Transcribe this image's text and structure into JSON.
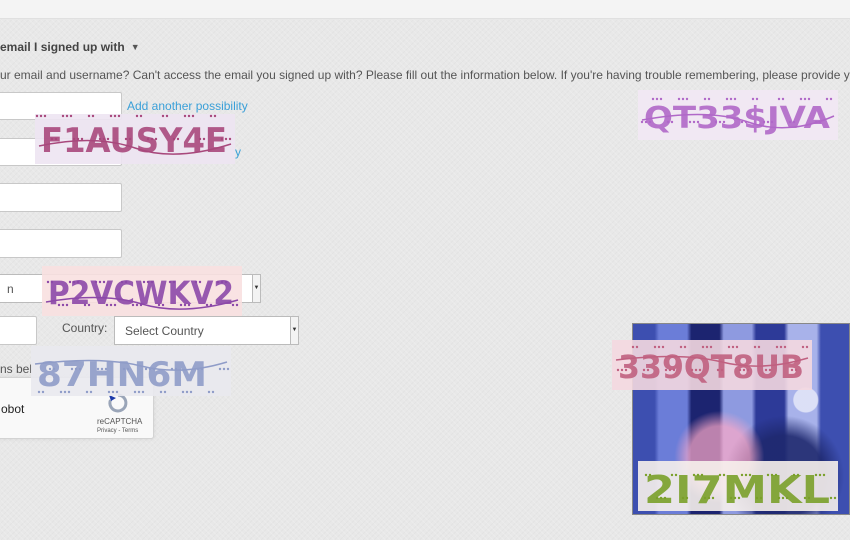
{
  "form": {
    "heading": "email I signed up with",
    "intro": "ur email and username? Can't access the email you signed up with? Please fill out the information below. If you're having trouble remembering, please provide your best gu",
    "add_possibility_1": "Add another possibility",
    "add_possibility_2": "y",
    "select1_value": "n",
    "country_label": "Country:",
    "country_value": "Select Country",
    "partial_text": "ns bel",
    "recaptcha": {
      "robot_text": "obot",
      "brand": "reCAPTCHA",
      "links": "Privacy - Terms"
    }
  },
  "captchas": [
    {
      "text": "F1AUSY4E",
      "color": "#a8487c",
      "bg": "#ede4f2"
    },
    {
      "text": "QT33$JVA",
      "color": "#b068c8",
      "bg": "#f2e8f4"
    },
    {
      "text": "P2VCWKV2",
      "color": "#8c48a8",
      "bg": "#f8e0e0"
    },
    {
      "text": "87HN6M",
      "color": "#8f9cc8",
      "bg": "#e9e9ee"
    },
    {
      "text": "339QT8UB",
      "color": "#c06080",
      "bg": "#f4d8e0"
    },
    {
      "text": "2I7MKL",
      "color": "#7aa02a",
      "bg": "#f7f1ec"
    }
  ],
  "icons": {
    "heading_caret": "caret-down-icon",
    "select_arrow": "chevron-down-icon",
    "recaptcha_logo": "recaptcha-logo-icon"
  }
}
